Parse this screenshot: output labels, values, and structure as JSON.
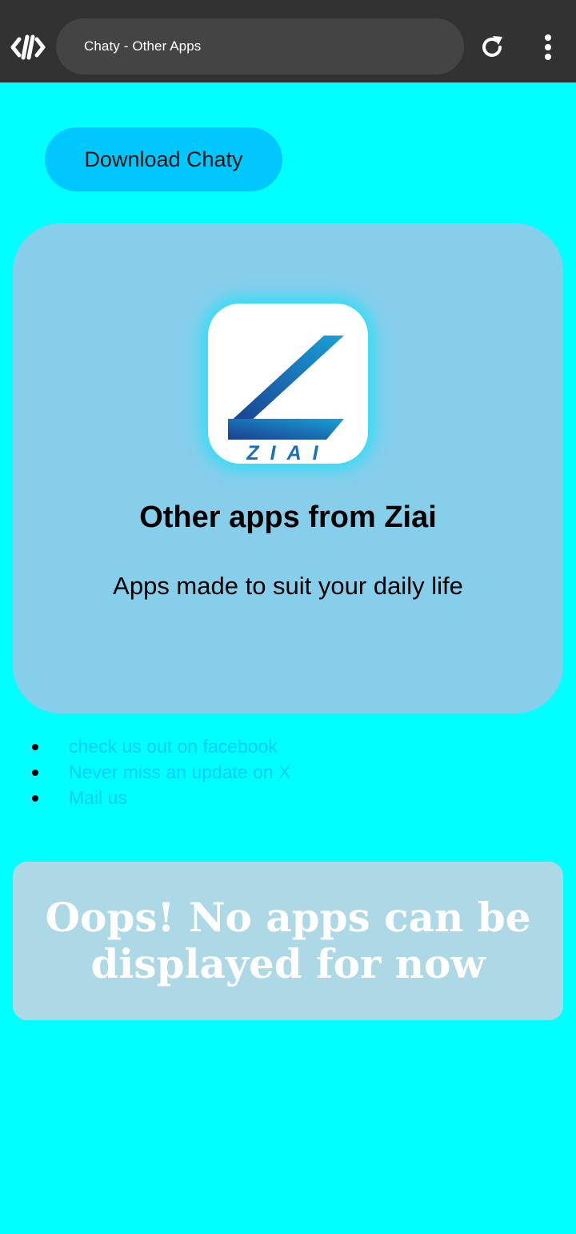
{
  "browser": {
    "tab_title": "Chaty - Other Apps",
    "brand_icon": "code-brackets-icon",
    "reload_icon": "reload-icon",
    "menu_icon": "more-vertical-icon",
    "bar_color": "#323232",
    "pill_color": "#444444"
  },
  "page": {
    "background": "#00ffff",
    "download_button": {
      "label": "Download Chaty",
      "color": "#00c8ff"
    },
    "hero": {
      "logo_text": "ZIAI",
      "title": "Other apps from Ziai",
      "subtitle": "Apps made to suit your daily life",
      "color": "#87ceeb"
    },
    "links": [
      {
        "label": "check us out on facebook"
      },
      {
        "label": "Never miss an update on X"
      },
      {
        "label": "Mail us"
      }
    ],
    "link_color": "#00ccff",
    "empty_state": {
      "message": "Oops! No apps can be displayed for now",
      "color": "#add8e6"
    }
  }
}
